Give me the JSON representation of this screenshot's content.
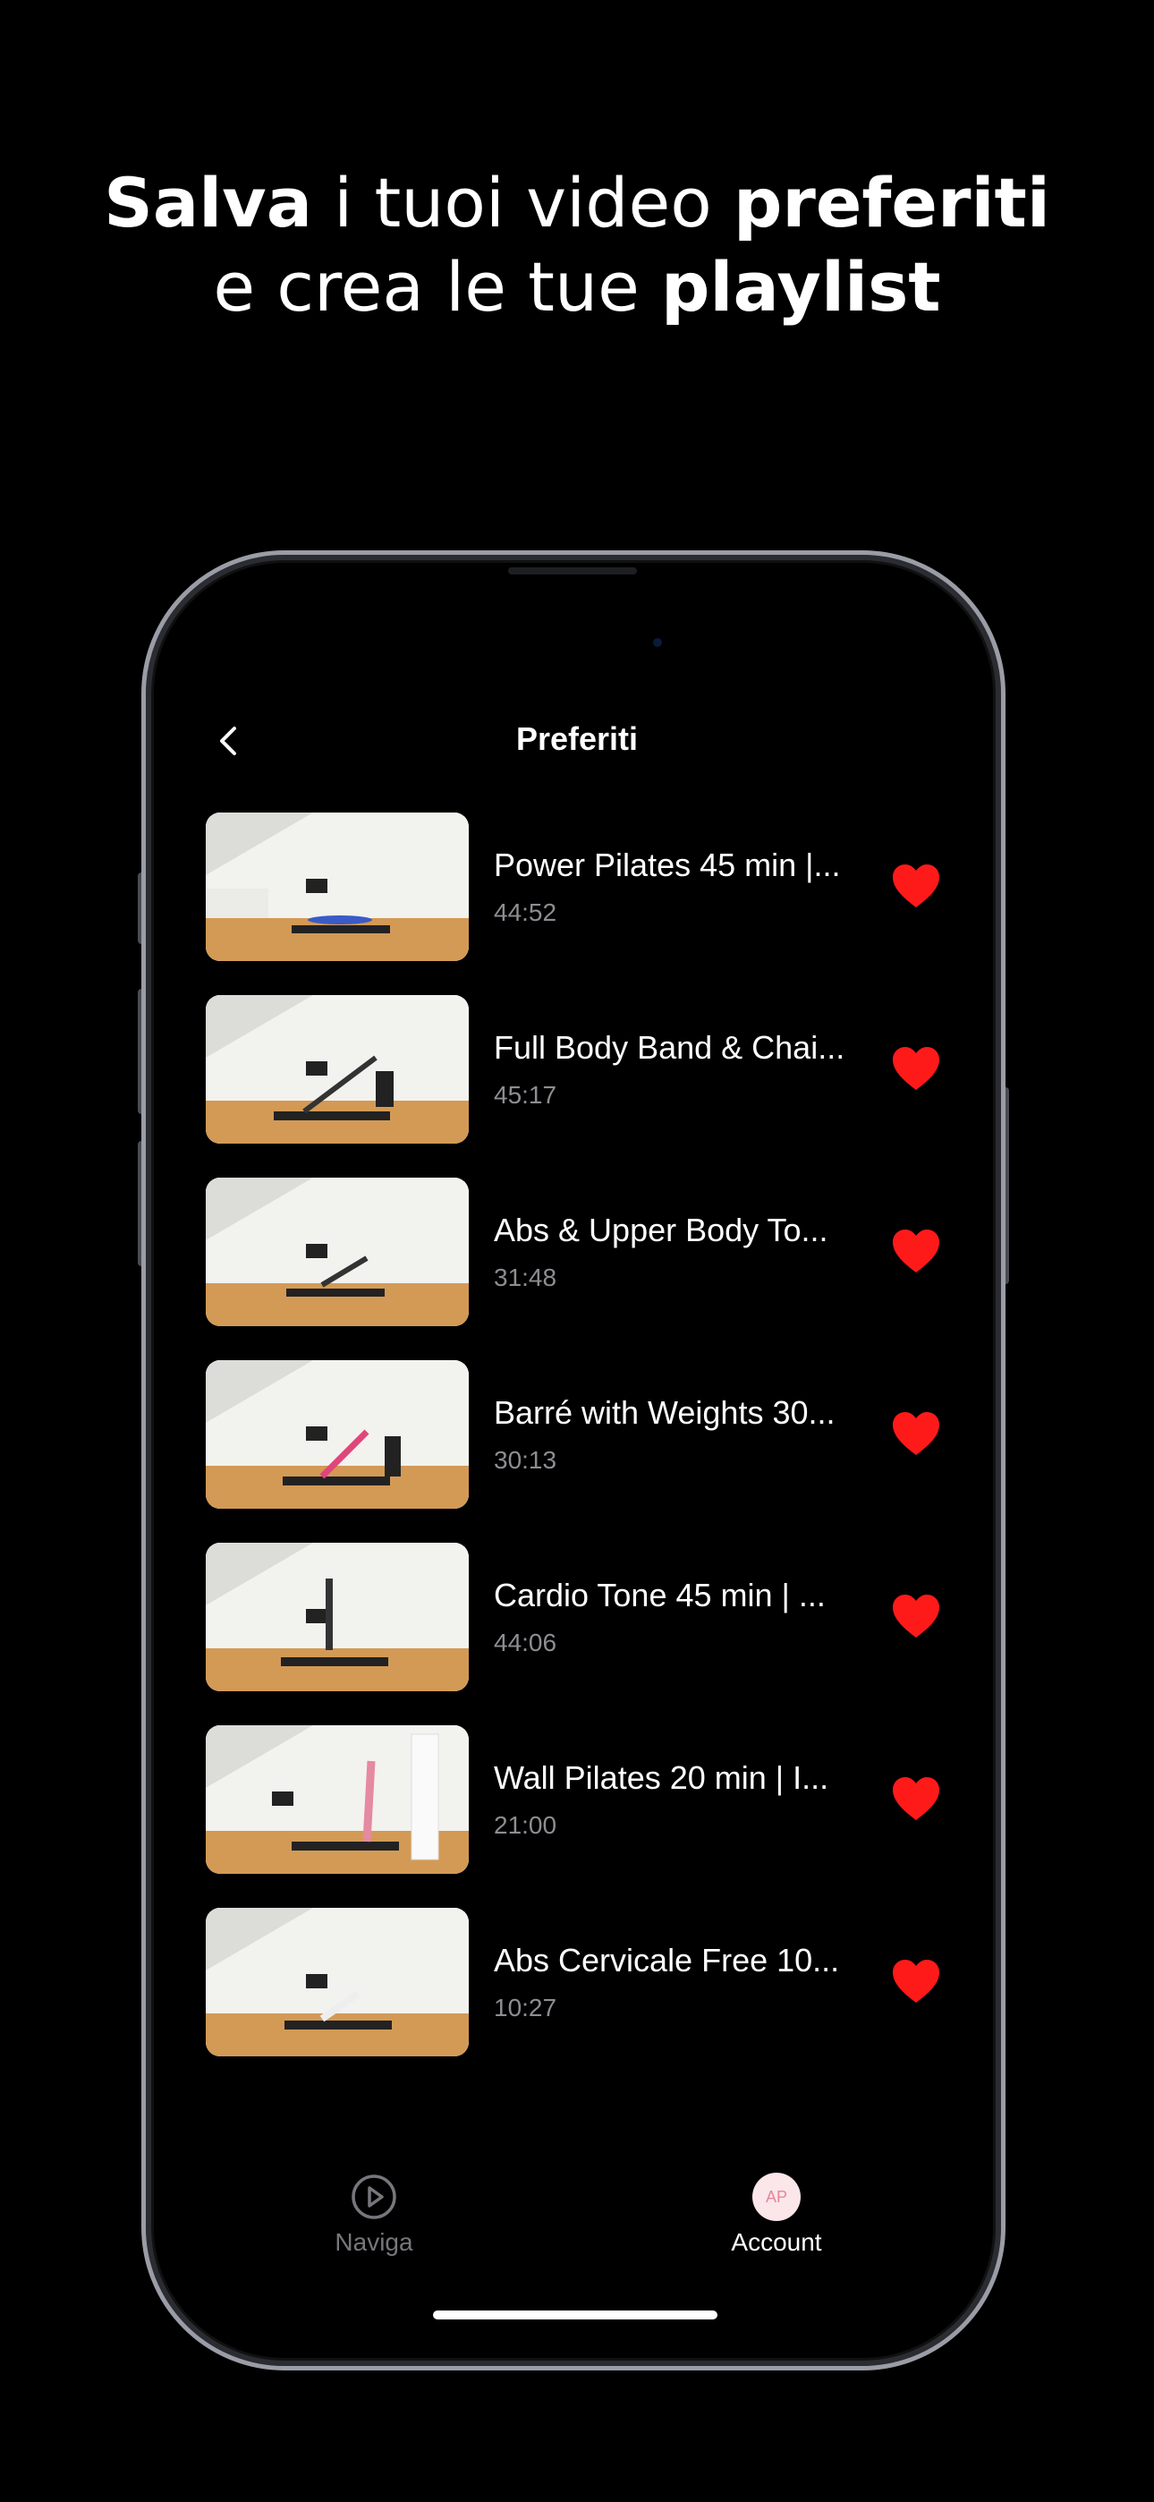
{
  "headline": {
    "line1_part1": "Salva",
    "line1_part2": " i tuoi video ",
    "line1_part3": "preferiti",
    "line2_part1": "e crea le tue ",
    "line2_part2": "playlist"
  },
  "nav": {
    "title": "Preferiti"
  },
  "favorites": [
    {
      "title": "Power Pilates 45 min |...",
      "duration": "44:52"
    },
    {
      "title": "Full Body Band & Chai...",
      "duration": "45:17"
    },
    {
      "title": "Abs & Upper Body To...",
      "duration": "31:48"
    },
    {
      "title": "Barré with Weights 30...",
      "duration": "30:13"
    },
    {
      "title": "Cardio Tone 45 min | ...",
      "duration": "44:06"
    },
    {
      "title": "Wall Pilates 20 min | I...",
      "duration": "21:00"
    },
    {
      "title": "Abs Cervicale Free 10...",
      "duration": "10:27"
    }
  ],
  "tabbar": {
    "naviga_label": "Naviga",
    "account_label": "Account",
    "avatar_initials": "AP"
  },
  "colors": {
    "heart": "#ff1a1a",
    "background": "#000000",
    "muted_text": "#8d8d92"
  }
}
